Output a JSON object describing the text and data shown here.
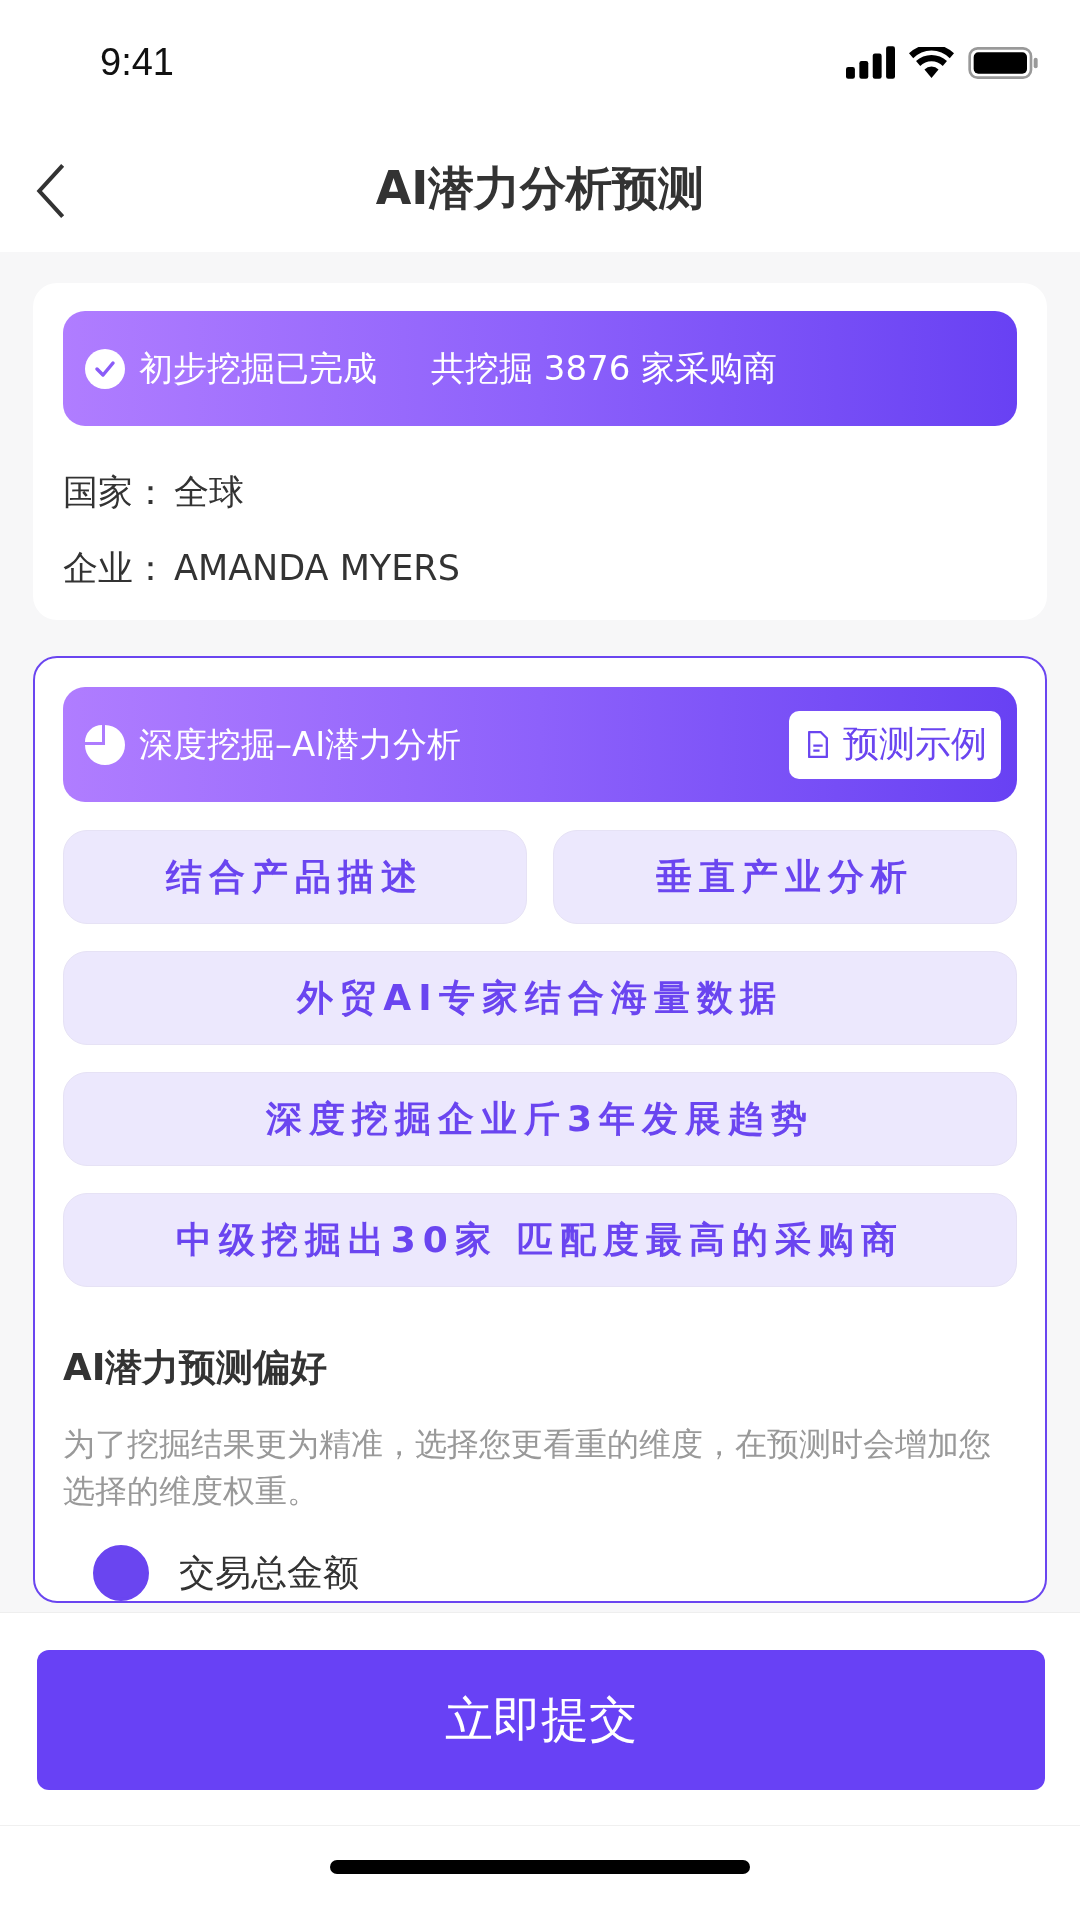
{
  "status_bar": {
    "time": "9:41"
  },
  "nav": {
    "title": "AI潜力分析预测"
  },
  "summary": {
    "banner": {
      "status": "初步挖掘已完成",
      "total": "共挖掘 3876 家采购商"
    },
    "fields": [
      {
        "label": "国家：",
        "value": "全球"
      },
      {
        "label": "企业：",
        "value": "AMANDA MYERS"
      }
    ]
  },
  "deep": {
    "banner": {
      "title": "深度挖掘–AI潜力分析",
      "example_button": "预测示例"
    },
    "features": [
      {
        "text": "结合产品描述",
        "kind": "half"
      },
      {
        "text": "垂直产业分析",
        "kind": "half"
      },
      {
        "text": "外贸AI专家结合海量数据",
        "kind": "full"
      },
      {
        "text": "深度挖掘企业斤3年发展趋势",
        "kind": "full"
      },
      {
        "text": "中级挖掘出30家 匹配度最高的采购商",
        "kind": "full"
      }
    ],
    "preference": {
      "title": "AI潜力预测偏好",
      "description": "为了挖掘结果更为精准，选择您更看重的维度，在预测时会增加您选择的维度权重。",
      "options": [
        {
          "label": "交易总金额",
          "selected": true
        }
      ]
    }
  },
  "submit_button": "立即提交"
}
